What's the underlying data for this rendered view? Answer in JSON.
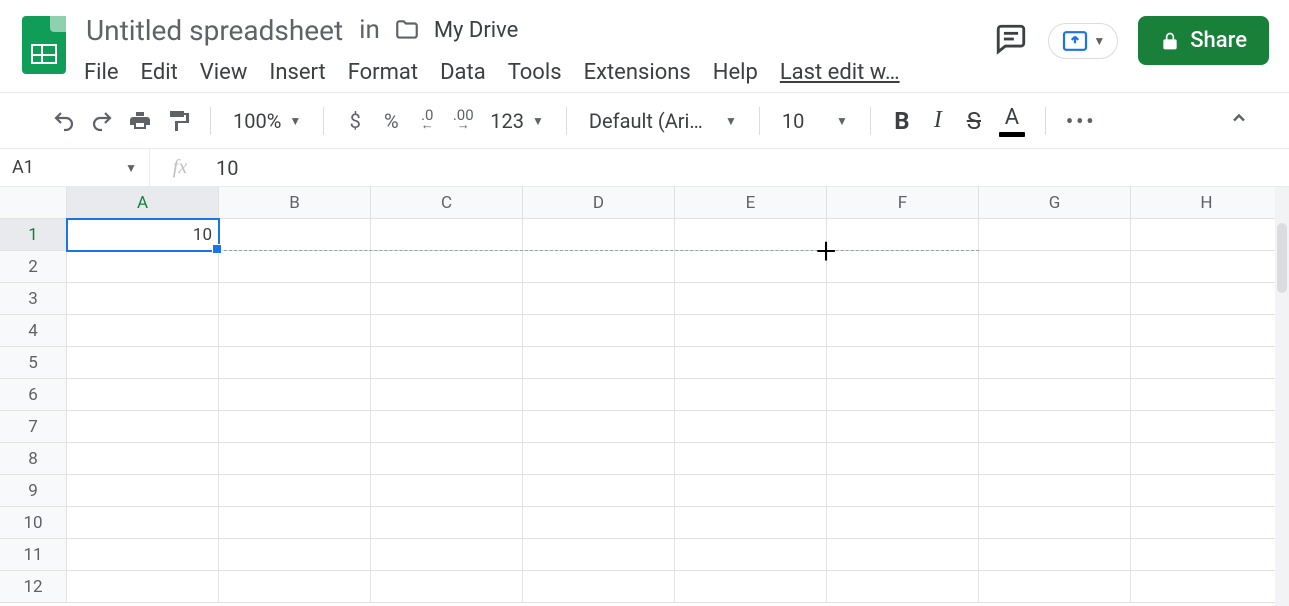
{
  "doc": {
    "title": "Untitled spreadsheet",
    "in_label": "in",
    "location": "My Drive",
    "last_edit": "Last edit w…"
  },
  "menus": [
    "File",
    "Edit",
    "View",
    "Insert",
    "Format",
    "Data",
    "Tools",
    "Extensions",
    "Help"
  ],
  "share": {
    "label": "Share"
  },
  "toolbar": {
    "zoom": "100%",
    "currency_label": "$",
    "percent_label": "%",
    "dec_dec": ".0",
    "inc_dec": ".00",
    "more_formats": "123",
    "font": "Default (Ari…",
    "font_size": "10",
    "more": "•••"
  },
  "fx": {
    "namebox": "A1",
    "fx_label": "fx",
    "value": "10"
  },
  "grid": {
    "columns": [
      "A",
      "B",
      "C",
      "D",
      "E",
      "F",
      "G",
      "H"
    ],
    "row_count": 12,
    "selected_col_index": 0,
    "selected_row_index": 0,
    "cells": {
      "A1": "10"
    }
  }
}
